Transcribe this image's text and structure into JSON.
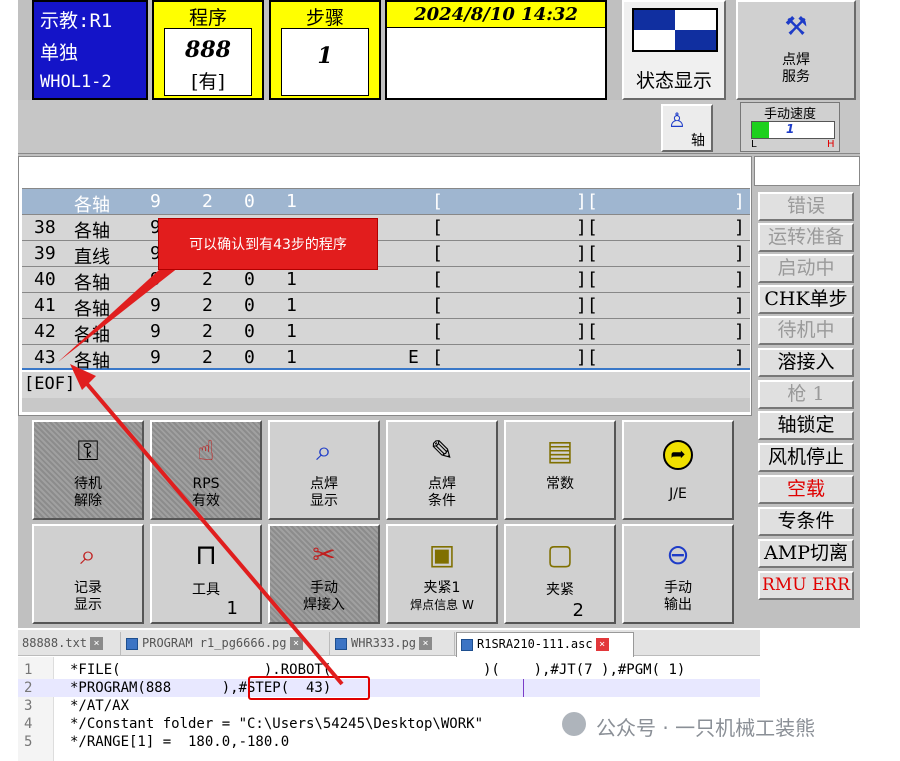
{
  "pendant": {
    "mode": {
      "line1": "示教:R1",
      "line2": "单独",
      "line3": "WHOL1-2"
    },
    "program": {
      "label": "程序",
      "number": "888",
      "tag": "[有]"
    },
    "step": {
      "label": "步骤",
      "number": "1"
    },
    "datetime": "2024/8/10 14:32",
    "status_display": "状态显示",
    "spot_service": {
      "line1": "点焊",
      "line2": "服务"
    },
    "axis_button": "轴",
    "jog_speed": {
      "label": "手动速度",
      "value": "1",
      "low": "L",
      "high": "H"
    },
    "program_rows": [
      {
        "num": "",
        "instr": "各轴",
        "c1": "9",
        "c2": "2",
        "c3": "0",
        "c4": "1",
        "flag": "",
        "b1": "[",
        "b2": "][",
        "b3": "]"
      },
      {
        "num": "38",
        "instr": "各轴",
        "c1": "9",
        "c2": "2",
        "c3": "0",
        "c4": "1",
        "flag": "",
        "b1": "[",
        "b2": "][",
        "b3": "]"
      },
      {
        "num": "39",
        "instr": "直线",
        "c1": "9",
        "c2": "2",
        "c3": "0",
        "c4": "1",
        "flag": "",
        "b1": "[",
        "b2": "][",
        "b3": "]"
      },
      {
        "num": "40",
        "instr": "各轴",
        "c1": "9",
        "c2": "2",
        "c3": "0",
        "c4": "1",
        "flag": "",
        "b1": "[",
        "b2": "][",
        "b3": "]"
      },
      {
        "num": "41",
        "instr": "各轴",
        "c1": "9",
        "c2": "2",
        "c3": "0",
        "c4": "1",
        "flag": "",
        "b1": "[",
        "b2": "][",
        "b3": "]"
      },
      {
        "num": "42",
        "instr": "各轴",
        "c1": "9",
        "c2": "2",
        "c3": "0",
        "c4": "1",
        "flag": "",
        "b1": "[",
        "b2": "][",
        "b3": "]"
      },
      {
        "num": "43",
        "instr": "各轴",
        "c1": "9",
        "c2": "2",
        "c3": "0",
        "c4": "1",
        "flag": "E",
        "b1": "[",
        "b2": "][",
        "b3": "]"
      }
    ],
    "eof": "[EOF]",
    "callout": "可以确认到有43步的程序",
    "side_buttons": [
      {
        "label": "错误",
        "color": "#9a9a9a"
      },
      {
        "label": "运转准备",
        "color": "#9a9a9a"
      },
      {
        "label": "启动中",
        "color": "#9a9a9a"
      },
      {
        "label": "CHK单步",
        "color": "#000000"
      },
      {
        "label": "待机中",
        "color": "#9a9a9a"
      },
      {
        "label": "溶接入",
        "color": "#000000"
      },
      {
        "label": "枪 1",
        "color": "#9a9a9a"
      },
      {
        "label": "轴锁定",
        "color": "#000000"
      },
      {
        "label": "风机停止",
        "color": "#000000"
      },
      {
        "label": "空载",
        "color": "#e00000"
      },
      {
        "label": "专条件",
        "color": "#000000"
      },
      {
        "label": "AMP切离",
        "color": "#000000"
      },
      {
        "label": "RMU ERR",
        "color": "#e00000"
      }
    ],
    "tiles": [
      {
        "icon": "key-icon",
        "glyph": "⚿",
        "line1": "待机",
        "line2": "解除",
        "sub": "",
        "grey": true
      },
      {
        "icon": "rps-icon",
        "glyph": "☝",
        "line1": "RPS",
        "line2": "有效",
        "sub": "",
        "grey": true
      },
      {
        "icon": "spot-display-icon",
        "glyph": "🔍",
        "line1": "点焊",
        "line2": "显示",
        "sub": "",
        "grey": false
      },
      {
        "icon": "spot-condition-icon",
        "glyph": "✎",
        "line1": "点焊",
        "line2": "条件",
        "sub": "",
        "grey": false
      },
      {
        "icon": "constant-icon",
        "glyph": "▤",
        "line1": "常数",
        "line2": "",
        "sub": "",
        "grey": false
      },
      {
        "icon": "jump-icon",
        "glyph": "➦",
        "line1": "J/E",
        "line2": "",
        "sub": "",
        "grey": false
      },
      {
        "icon": "record-display-icon",
        "glyph": "🔎",
        "line1": "记录",
        "line2": "显示",
        "sub": "",
        "grey": false
      },
      {
        "icon": "tool-icon",
        "glyph": "⊓",
        "line1": "工具",
        "line2": "",
        "sub": "1",
        "grey": false
      },
      {
        "icon": "manual-weld-icon",
        "glyph": "✂",
        "line1": "手动",
        "line2": "焊接入",
        "sub": "",
        "grey": true
      },
      {
        "icon": "clamp-info-icon",
        "glyph": "▣",
        "line1": "夹紧1",
        "line2": "焊点信息 W",
        "sub": "",
        "grey": false
      },
      {
        "icon": "clamp-icon",
        "glyph": "▢",
        "line1": "夹紧",
        "line2": "",
        "sub": "2",
        "grey": false
      },
      {
        "icon": "manual-output-icon",
        "glyph": "⊖",
        "line1": "手动",
        "line2": "输出",
        "sub": "",
        "grey": false
      }
    ]
  },
  "editor": {
    "tabs": [
      {
        "label": "88888.txt",
        "active": false
      },
      {
        "label": "PROGRAM r1_pg6666.pg",
        "active": false
      },
      {
        "label": "WHR333.pg",
        "active": false
      },
      {
        "label": "R1SRA210-111.asc",
        "active": true
      }
    ],
    "lines": [
      {
        "n": "1",
        "text": "*FILE(                 ).ROBOT(                  )(    ),#JT(7 ),#PGM( 1)"
      },
      {
        "n": "2",
        "text": "*PROGRAM(888      ),#STEP(  43)"
      },
      {
        "n": "3",
        "text": "*/AT/AX"
      },
      {
        "n": "4",
        "text": "*/Constant folder = \"C:\\Users\\54245\\Desktop\\WORK\""
      },
      {
        "n": "5",
        "text": "*/RANGE[1] =  180.0,-180.0"
      }
    ]
  },
  "watermark": "公众号 · 一只机械工装熊"
}
